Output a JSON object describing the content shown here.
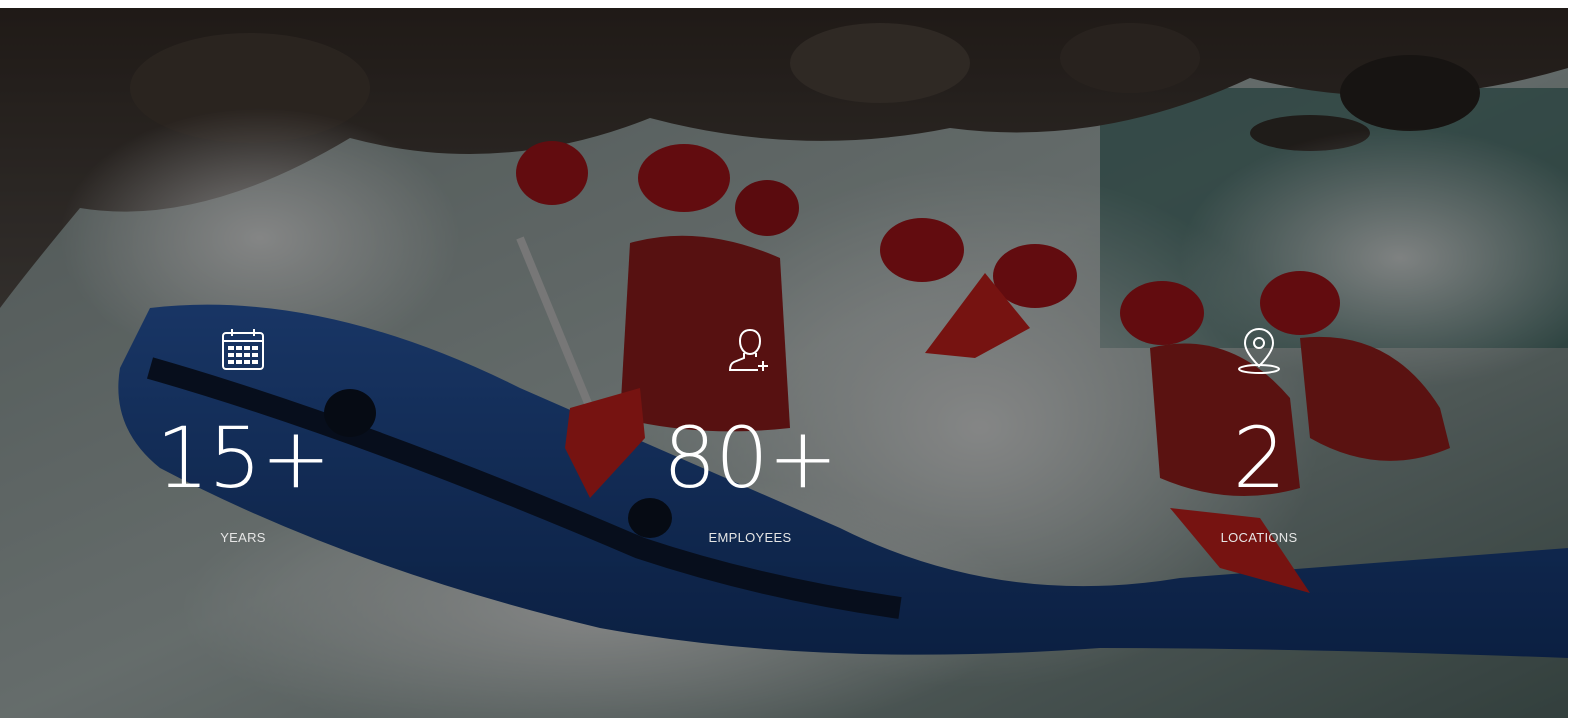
{
  "stats": [
    {
      "icon": "calendar-icon",
      "value": "15+",
      "label": "YEARS"
    },
    {
      "icon": "user-add-icon",
      "value": "80+",
      "label": "EMPLOYEES"
    },
    {
      "icon": "location-pin-icon",
      "value": "2",
      "label": "LOCATIONS"
    }
  ],
  "colors": {
    "overlay": "#000000",
    "text": "#ffffff",
    "raft": "#1f4f9e",
    "helmet": "#b3161d",
    "water": "#c9d6d4"
  }
}
